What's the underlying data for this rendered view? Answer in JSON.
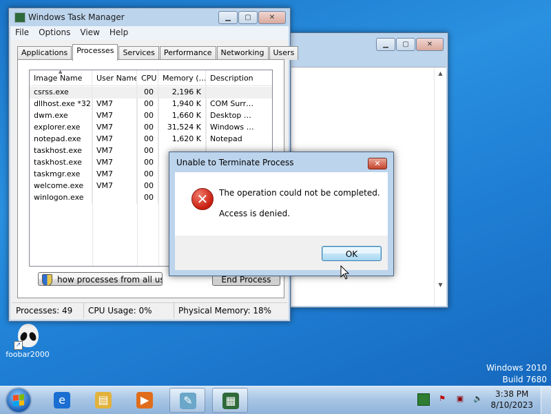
{
  "desktop": {
    "watermark": {
      "line1": "Windows 2010",
      "line2": "Build 7680"
    },
    "icons": [
      {
        "label": "foobar2000",
        "icon": "alien-icon"
      }
    ]
  },
  "task_manager": {
    "title": "Windows Task Manager",
    "menu": [
      "File",
      "Options",
      "View",
      "Help"
    ],
    "tabs": [
      "Applications",
      "Processes",
      "Services",
      "Performance",
      "Networking",
      "Users"
    ],
    "active_tab": "Processes",
    "columns": [
      "Image Name",
      "User Name",
      "CPU",
      "Memory (…",
      "Description"
    ],
    "processes": [
      {
        "image": "csrss.exe",
        "user": "",
        "cpu": "00",
        "memory": "2,196 K",
        "description": ""
      },
      {
        "image": "dllhost.exe *32",
        "user": "VM7",
        "cpu": "00",
        "memory": "1,940 K",
        "description": "COM Surr…"
      },
      {
        "image": "dwm.exe",
        "user": "VM7",
        "cpu": "00",
        "memory": "1,660 K",
        "description": "Desktop …"
      },
      {
        "image": "explorer.exe",
        "user": "VM7",
        "cpu": "00",
        "memory": "31,524 K",
        "description": "Windows …"
      },
      {
        "image": "notepad.exe",
        "user": "VM7",
        "cpu": "00",
        "memory": "1,620 K",
        "description": "Notepad"
      },
      {
        "image": "taskhost.exe",
        "user": "VM7",
        "cpu": "00",
        "memory": "",
        "description": ""
      },
      {
        "image": "taskhost.exe",
        "user": "VM7",
        "cpu": "00",
        "memory": "",
        "description": ""
      },
      {
        "image": "taskmgr.exe",
        "user": "VM7",
        "cpu": "00",
        "memory": "",
        "description": ""
      },
      {
        "image": "welcome.exe",
        "user": "VM7",
        "cpu": "00",
        "memory": "",
        "description": ""
      },
      {
        "image": "winlogon.exe",
        "user": "",
        "cpu": "00",
        "memory": "",
        "description": ""
      }
    ],
    "show_all_label": "how processes from all user",
    "end_process_label": "End Process",
    "status": {
      "processes": "Processes: 49",
      "cpu": "CPU Usage: 0%",
      "memory": "Physical Memory: 18%"
    }
  },
  "dialog": {
    "title": "Unable to Terminate Process",
    "message": "The operation could not be completed.",
    "detail": "Access is denied.",
    "ok_label": "OK",
    "close_glyph": "✕",
    "icon": "error-icon"
  },
  "taskbar": {
    "pinned": [
      {
        "name": "internet-explorer-icon",
        "glyph": "e",
        "color": "#1b6ed2"
      },
      {
        "name": "explorer-folder-icon",
        "glyph": "▤",
        "color": "#e1b23c"
      },
      {
        "name": "media-player-icon",
        "glyph": "▶",
        "color": "#e06d1c"
      },
      {
        "name": "notepad-icon",
        "glyph": "✎",
        "color": "#6aa7c9"
      },
      {
        "name": "task-manager-icon",
        "glyph": "▦",
        "color": "#2f6a3a"
      }
    ],
    "tray_icons": [
      "battery-icon",
      "flag-icon",
      "network-icon",
      "volume-icon"
    ],
    "clock": {
      "time": "3:38 PM",
      "date": "8/10/2023"
    }
  },
  "colors": {
    "desktop": "#1f7fd4",
    "window_frame": "#bcd4ec",
    "error_red": "#c81e10"
  }
}
